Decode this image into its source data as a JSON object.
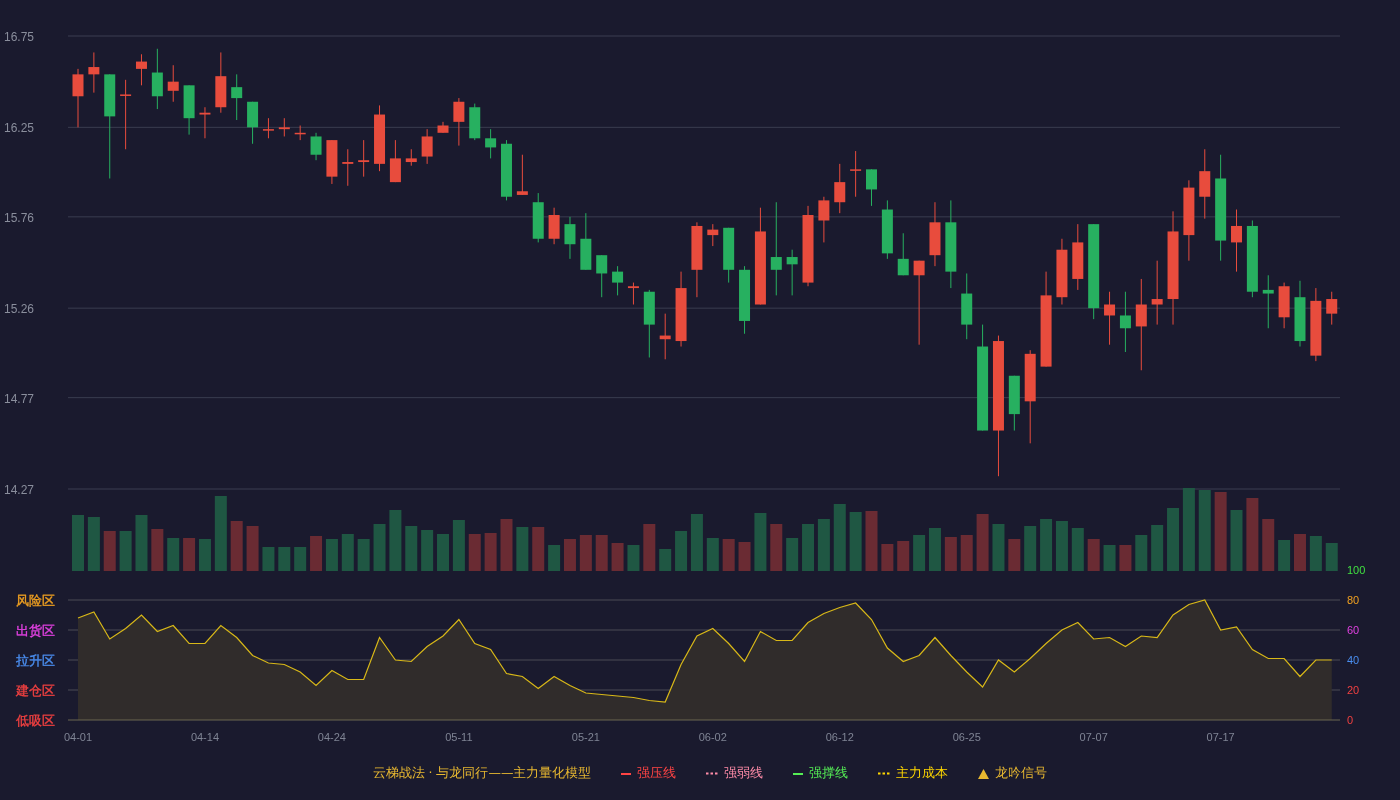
{
  "price_chart": {
    "chart_data": {
      "type": "candlestick",
      "grid": true,
      "ylim": [
        14.27,
        16.75
      ],
      "yticks": [
        16.75,
        16.25,
        15.76,
        15.26,
        14.77,
        14.27
      ],
      "categories": [
        null,
        null,
        null,
        null,
        null,
        null,
        null,
        null,
        null,
        null,
        null,
        null,
        null,
        null,
        null,
        null,
        null,
        null,
        null,
        null,
        null,
        null,
        null,
        null,
        null,
        null,
        null,
        null,
        null,
        null,
        null,
        null,
        null,
        null,
        null,
        null,
        null,
        null,
        null,
        null,
        null,
        null,
        null,
        null,
        null,
        null,
        null,
        null,
        null,
        null,
        null,
        null,
        null,
        null,
        null,
        null,
        null,
        null,
        null,
        null,
        null,
        null,
        null,
        null,
        null,
        null,
        null,
        null,
        null,
        null,
        null,
        null,
        null,
        null,
        null,
        null,
        null,
        null,
        null,
        null
      ],
      "ohlc": [
        [
          16.42,
          16.57,
          16.25,
          16.54
        ],
        [
          16.54,
          16.66,
          16.44,
          16.58
        ],
        [
          16.54,
          16.54,
          15.97,
          16.31
        ],
        [
          16.43,
          16.51,
          16.13,
          16.43
        ],
        [
          16.57,
          16.65,
          16.48,
          16.61
        ],
        [
          16.55,
          16.68,
          16.35,
          16.42
        ],
        [
          16.45,
          16.59,
          16.39,
          16.5
        ],
        [
          16.48,
          16.48,
          16.21,
          16.3
        ],
        [
          16.32,
          16.36,
          16.19,
          16.33
        ],
        [
          16.36,
          16.66,
          16.33,
          16.53
        ],
        [
          16.47,
          16.54,
          16.29,
          16.41
        ],
        [
          16.39,
          16.39,
          16.16,
          16.25
        ],
        [
          16.24,
          16.3,
          16.19,
          16.24
        ],
        [
          16.24,
          16.3,
          16.2,
          16.25
        ],
        [
          16.22,
          16.26,
          16.18,
          16.22
        ],
        [
          16.2,
          16.22,
          16.07,
          16.1
        ],
        [
          15.98,
          16.18,
          15.94,
          16.18
        ],
        [
          16.05,
          16.13,
          15.93,
          16.06
        ],
        [
          16.06,
          16.18,
          15.98,
          16.07
        ],
        [
          16.05,
          16.37,
          16.01,
          16.32
        ],
        [
          15.95,
          16.18,
          15.95,
          16.08
        ],
        [
          16.06,
          16.13,
          16.04,
          16.08
        ],
        [
          16.09,
          16.24,
          16.05,
          16.2
        ],
        [
          16.22,
          16.28,
          16.22,
          16.26
        ],
        [
          16.28,
          16.41,
          16.15,
          16.39
        ],
        [
          16.36,
          16.38,
          16.18,
          16.19
        ],
        [
          16.19,
          16.24,
          16.08,
          16.14
        ],
        [
          16.16,
          16.18,
          15.85,
          15.87
        ],
        [
          15.88,
          16.1,
          15.88,
          15.9
        ],
        [
          15.84,
          15.89,
          15.62,
          15.64
        ],
        [
          15.64,
          15.81,
          15.61,
          15.77
        ],
        [
          15.72,
          15.76,
          15.53,
          15.61
        ],
        [
          15.64,
          15.78,
          15.47,
          15.47
        ],
        [
          15.55,
          15.55,
          15.32,
          15.45
        ],
        [
          15.46,
          15.49,
          15.33,
          15.4
        ],
        [
          15.37,
          15.4,
          15.28,
          15.38
        ],
        [
          15.35,
          15.36,
          14.99,
          15.17
        ],
        [
          15.09,
          15.23,
          14.98,
          15.11
        ],
        [
          15.08,
          15.46,
          15.05,
          15.37
        ],
        [
          15.47,
          15.73,
          15.32,
          15.71
        ],
        [
          15.66,
          15.72,
          15.6,
          15.69
        ],
        [
          15.7,
          15.7,
          15.4,
          15.47
        ],
        [
          15.47,
          15.49,
          15.12,
          15.19
        ],
        [
          15.28,
          15.81,
          15.28,
          15.68
        ],
        [
          15.54,
          15.84,
          15.33,
          15.47
        ],
        [
          15.54,
          15.58,
          15.33,
          15.5
        ],
        [
          15.4,
          15.82,
          15.38,
          15.77
        ],
        [
          15.74,
          15.87,
          15.62,
          15.85
        ],
        [
          15.84,
          16.05,
          15.78,
          15.95
        ],
        [
          16.02,
          16.12,
          15.87,
          16.02
        ],
        [
          16.02,
          16.02,
          15.82,
          15.91
        ],
        [
          15.8,
          15.85,
          15.53,
          15.56
        ],
        [
          15.53,
          15.67,
          15.44,
          15.44
        ],
        [
          15.44,
          15.52,
          15.06,
          15.52
        ],
        [
          15.55,
          15.84,
          15.49,
          15.73
        ],
        [
          15.73,
          15.85,
          15.37,
          15.46
        ],
        [
          15.34,
          15.45,
          15.09,
          15.17
        ],
        [
          15.05,
          15.17,
          14.59,
          14.59
        ],
        [
          14.59,
          15.11,
          14.34,
          15.08
        ],
        [
          14.89,
          14.89,
          14.59,
          14.68
        ],
        [
          14.75,
          15.03,
          14.52,
          15.01
        ],
        [
          14.94,
          15.46,
          14.94,
          15.33
        ],
        [
          15.32,
          15.64,
          15.28,
          15.58
        ],
        [
          15.42,
          15.72,
          15.36,
          15.62
        ],
        [
          15.72,
          15.72,
          15.2,
          15.26
        ],
        [
          15.22,
          15.35,
          15.06,
          15.28
        ],
        [
          15.22,
          15.35,
          15.02,
          15.15
        ],
        [
          15.16,
          15.42,
          14.92,
          15.28
        ],
        [
          15.28,
          15.52,
          15.17,
          15.31
        ],
        [
          15.31,
          15.79,
          15.17,
          15.68
        ],
        [
          15.66,
          15.96,
          15.52,
          15.92
        ],
        [
          15.87,
          16.13,
          15.75,
          16.01
        ],
        [
          15.97,
          16.1,
          15.52,
          15.63
        ],
        [
          15.62,
          15.8,
          15.46,
          15.71
        ],
        [
          15.71,
          15.74,
          15.32,
          15.35
        ],
        [
          15.36,
          15.44,
          15.15,
          15.34
        ],
        [
          15.21,
          15.4,
          15.15,
          15.38
        ],
        [
          15.32,
          15.41,
          15.05,
          15.08
        ],
        [
          15.0,
          15.37,
          14.97,
          15.3
        ],
        [
          15.23,
          15.35,
          15.17,
          15.31
        ]
      ]
    }
  },
  "indicator_chart": {
    "zones": [
      {
        "label": "风险区",
        "color": "#f0a020"
      },
      {
        "label": "出货区",
        "color": "#e040e0"
      },
      {
        "label": "拉升区",
        "color": "#4a8ef0"
      },
      {
        "label": "建仓区",
        "color": "#f04040"
      },
      {
        "label": "低吸区",
        "color": "#f04040"
      }
    ],
    "chart_data": {
      "type": "area",
      "grid": true,
      "ylim": [
        0,
        100
      ],
      "yticks": [
        {
          "value": 100,
          "label": "100"
        },
        {
          "value": 80,
          "label": "80"
        },
        {
          "value": 60,
          "label": "60"
        },
        {
          "value": 40,
          "label": "40"
        },
        {
          "value": 20,
          "label": "20"
        },
        {
          "value": 0,
          "label": "0"
        }
      ],
      "categories": [
        "04-01",
        null,
        null,
        null,
        null,
        null,
        null,
        null,
        "04-14",
        null,
        null,
        null,
        null,
        null,
        null,
        null,
        "04-24",
        null,
        null,
        null,
        null,
        null,
        null,
        null,
        "05-11",
        null,
        null,
        null,
        null,
        null,
        null,
        null,
        "05-21",
        null,
        null,
        null,
        null,
        null,
        null,
        null,
        "06-02",
        null,
        null,
        null,
        null,
        null,
        null,
        null,
        "06-12",
        null,
        null,
        null,
        null,
        null,
        null,
        null,
        "06-25",
        null,
        null,
        null,
        null,
        null,
        null,
        null,
        "07-07",
        null,
        null,
        null,
        null,
        null,
        null,
        null,
        "07-17",
        null,
        null,
        null,
        null,
        null,
        null,
        null
      ],
      "series": [
        {
          "color": "#d8b818",
          "values": [
            68,
            72,
            54,
            61,
            70,
            59,
            63,
            51,
            51,
            63,
            55,
            43,
            38,
            37,
            32,
            23,
            33,
            27,
            27,
            55,
            40,
            39,
            49,
            56,
            67,
            51,
            47,
            31,
            29,
            21,
            29,
            23,
            18,
            17,
            16,
            15,
            13,
            12,
            37,
            56,
            61,
            51,
            39,
            59,
            53,
            53,
            65,
            71,
            75,
            78,
            67,
            48,
            39,
            43,
            55,
            43,
            32,
            22,
            40,
            32,
            41,
            51,
            60,
            65,
            54,
            55,
            49,
            56,
            55,
            70,
            77,
            80,
            60,
            62,
            47,
            41,
            41,
            29,
            40,
            40
          ]
        }
      ]
    }
  },
  "legend": [
    {
      "kind": "title",
      "label": "云梯战法 · 与龙同行——主力量化模型",
      "color": "#e8b830"
    },
    {
      "kind": "line",
      "label": "强压线",
      "color": "#ff4444"
    },
    {
      "kind": "dash",
      "label": "强弱线",
      "color": "#ff8ca8"
    },
    {
      "kind": "line",
      "label": "强撑线",
      "color": "#55ee55"
    },
    {
      "kind": "dash",
      "label": "主力成本",
      "color": "#ffd700"
    },
    {
      "kind": "triangle",
      "label": "龙吟信号",
      "color": "#e8b830"
    }
  ]
}
